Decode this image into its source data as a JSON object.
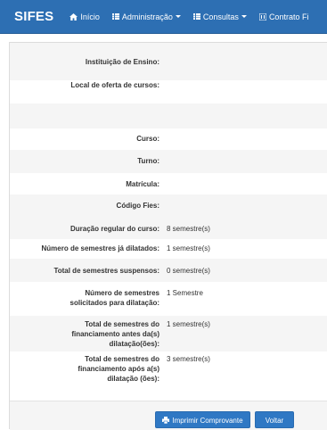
{
  "navbar": {
    "brand": "SIFES",
    "items": [
      {
        "label": "Início",
        "icon": "home-icon",
        "dropdown": false
      },
      {
        "label": "Administração",
        "icon": "list-icon",
        "dropdown": true
      },
      {
        "label": "Consultas",
        "icon": "list-icon",
        "dropdown": true
      },
      {
        "label": "Contrato Fi",
        "icon": "document-icon",
        "dropdown": false
      }
    ]
  },
  "details": {
    "instituicao": {
      "label": "Instituição de Ensino:",
      "value": ""
    },
    "local_oferta": {
      "label": "Local de oferta de cursos:",
      "value": ""
    },
    "curso": {
      "label": "Curso:",
      "value": ""
    },
    "turno": {
      "label": "Turno:",
      "value": ""
    },
    "matricula": {
      "label": "Matrícula:",
      "value": ""
    },
    "codigo_fies": {
      "label": "Código Fies:",
      "value": ""
    },
    "duracao": {
      "label": "Duração regular do curso:",
      "value": "8 semestre(s)"
    },
    "dilatados": {
      "label": "Número de semestres já dilatados:",
      "value": "1 semestre(s)"
    },
    "suspensos": {
      "label": "Total de semestres suspensos:",
      "value": "0 semestre(s)"
    },
    "solicitados": {
      "label": "Número de semestres solicitados para dilatação:",
      "value": "1 Semestre"
    },
    "antes": {
      "label": "Total de semestres do financiamento antes da(s) dilatação(ões):",
      "value": "1 semestre(s)"
    },
    "apos": {
      "label": "Total de semestres do financiamento após a(s) dilatação (ões):",
      "value": "3 semestre(s)"
    }
  },
  "actions": {
    "print_label": "Imprimir Comprovante",
    "back_label": "Voltar"
  },
  "colors": {
    "navbar": "#2d6fb3",
    "button": "#2f78c4",
    "stripe": "#f5f5f5"
  }
}
